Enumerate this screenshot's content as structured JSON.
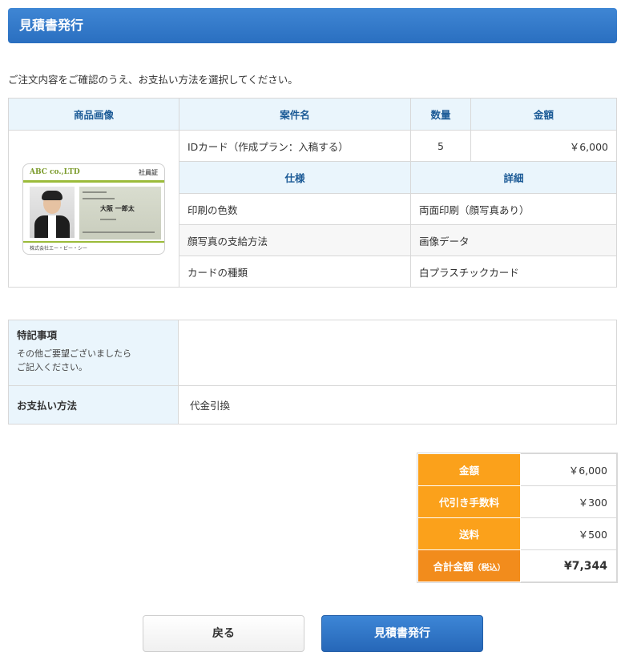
{
  "header": {
    "title": "見積書発行"
  },
  "intro": "ご注文内容をご確認のうえ、お支払い方法を選択してください。",
  "order": {
    "headers": {
      "image": "商品画像",
      "case": "案件名",
      "qty": "数量",
      "amount": "金額"
    },
    "item": {
      "name": "IDカード（作成プラン：入稿する）",
      "qty": "5",
      "amount": "￥6,000"
    },
    "spec_headers": {
      "spec": "仕様",
      "detail": "詳細"
    },
    "specs": [
      {
        "spec": "印刷の色数",
        "detail": "両面印刷（顔写真あり）"
      },
      {
        "spec": "顔写真の支給方法",
        "detail": "画像データ"
      },
      {
        "spec": "カードの種類",
        "detail": "白プラスチックカード"
      }
    ],
    "card_image": {
      "logo": "ABC co.,LTD",
      "badge": "社員証",
      "name": "大阪 一郎太",
      "company": "株式会社エー・ビー・シー"
    }
  },
  "notes": {
    "label": "特記事項",
    "hint_line1": "その他ご要望ございましたら",
    "hint_line2": "ご記入ください。",
    "value": ""
  },
  "payment": {
    "label": "お支払い方法",
    "value": "代金引換"
  },
  "summary": {
    "amount_label": "金額",
    "amount_value": "￥6,000",
    "fee_label": "代引き手数料",
    "fee_value": "￥300",
    "shipping_label": "送料",
    "shipping_value": "￥500",
    "total_label": "合計金額",
    "total_tax": "（税込）",
    "total_value": "¥7,344"
  },
  "buttons": {
    "back": "戻る",
    "issue": "見積書発行"
  },
  "colors": {
    "header": "#2f77c8",
    "summary_key": "#fba11b",
    "table_header": "#eaf5fc"
  }
}
